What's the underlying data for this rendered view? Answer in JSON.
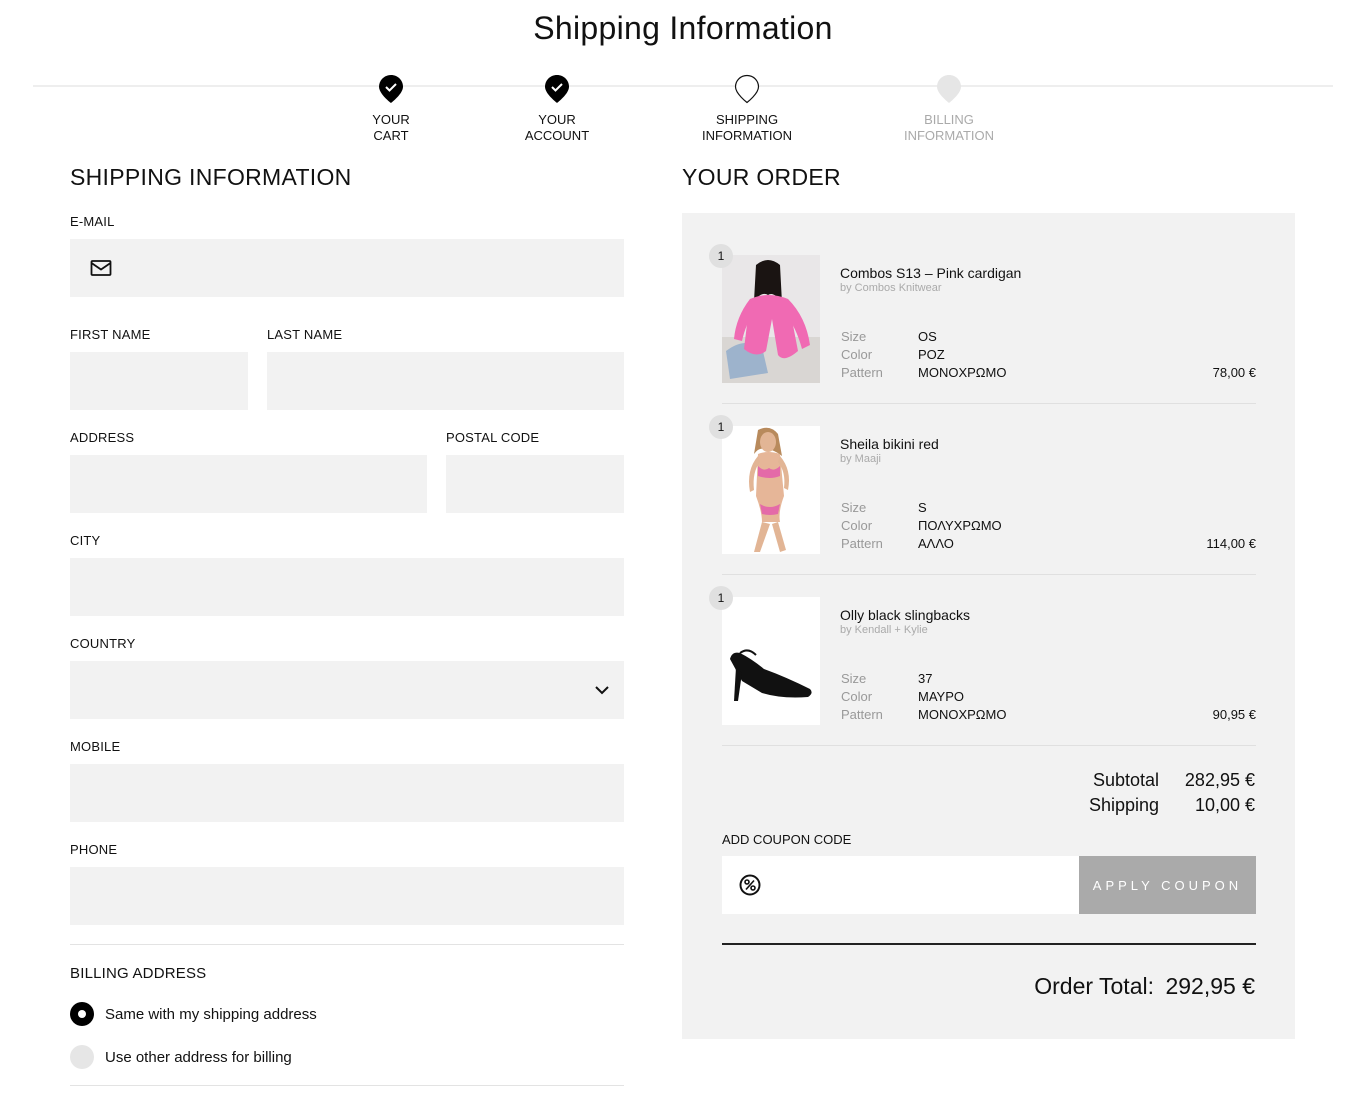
{
  "page_title": "Shipping Information",
  "steps": [
    {
      "line1": "YOUR",
      "line2": "CART",
      "state": "done"
    },
    {
      "line1": "YOUR",
      "line2": "ACCOUNT",
      "state": "done"
    },
    {
      "line1": "SHIPPING",
      "line2": "INFORMATION",
      "state": "current"
    },
    {
      "line1": "BILLING",
      "line2": "INFORMATION",
      "state": "upcoming"
    }
  ],
  "shipping": {
    "heading": "SHIPPING INFORMATION",
    "email_label": "E-MAIL",
    "first_name_label": "FIRST NAME",
    "last_name_label": "LAST NAME",
    "address_label": "ADDRESS",
    "postal_code_label": "POSTAL CODE",
    "city_label": "CITY",
    "country_label": "COUNTRY",
    "mobile_label": "MOBILE",
    "phone_label": "PHONE",
    "email_value": "",
    "first_name_value": "",
    "last_name_value": "",
    "address_value": "",
    "postal_code_value": "",
    "city_value": "",
    "country_value": "",
    "mobile_value": "",
    "phone_value": "",
    "icons": {
      "email": "mail-icon",
      "country": "chevron-down-icon"
    }
  },
  "billing": {
    "heading": "BILLING ADDRESS",
    "option_same": "Same with my shipping address",
    "option_other": "Use other address for billing",
    "selected": "same"
  },
  "order": {
    "heading": "YOUR ORDER",
    "attr_labels": {
      "size": "Size",
      "color": "Color",
      "pattern": "Pattern"
    },
    "items": [
      {
        "qty": "1",
        "name": "Combos S13 – Pink cardigan",
        "brand": "by Combos Knitwear",
        "size": "OS",
        "color": "ΡΟΖ",
        "pattern": "ΜΟΝΟΧΡΩΜΟ",
        "price": "78,00 €"
      },
      {
        "qty": "1",
        "name": "Sheila bikini red",
        "brand": "by Maaji",
        "size": "S",
        "color": "ΠΟΛΥΧΡΩΜΟ",
        "pattern": "ΑΛΛΟ",
        "price": "114,00 €"
      },
      {
        "qty": "1",
        "name": "Olly black slingbacks",
        "brand": "by Kendall + Kylie",
        "size": "37",
        "color": "ΜΑΥΡΟ",
        "pattern": "ΜΟΝΟΧΡΩΜΟ",
        "price": "90,95 €"
      }
    ],
    "subtotal_label": "Subtotal",
    "subtotal_value": "282,95 €",
    "shipping_label": "Shipping",
    "shipping_value": "10,00 €",
    "coupon_label": "ADD COUPON CODE",
    "coupon_value": "",
    "coupon_icon": "percent-icon",
    "apply_coupon": "APPLY COUPON",
    "total_label": "Order Total:",
    "total_value": "292,95 €"
  },
  "colors": {
    "field_bg": "#f2f2f2",
    "panel_bg": "#f2f2f2",
    "accent": "#000000",
    "button_disabled": "#aaaaaa"
  }
}
